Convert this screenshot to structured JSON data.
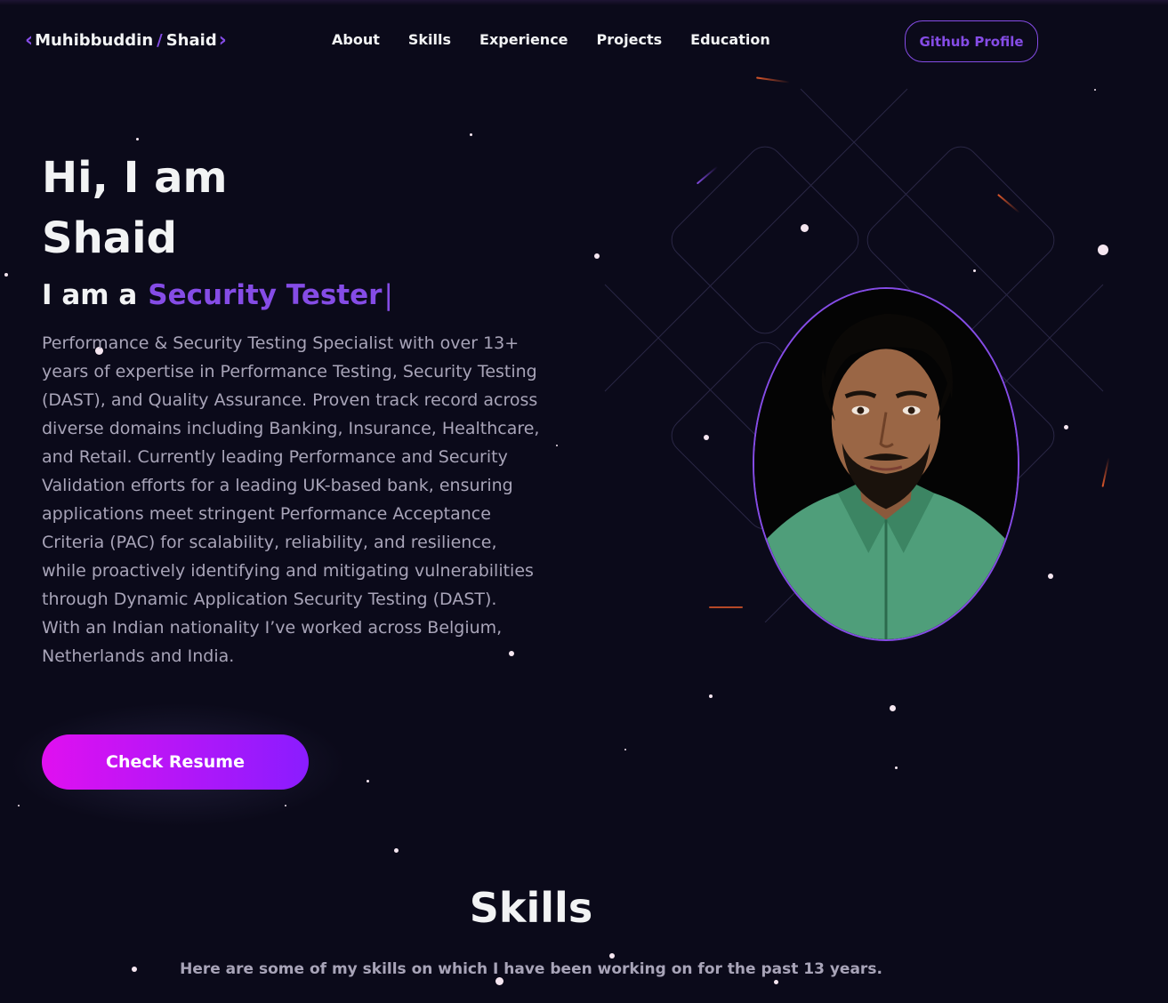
{
  "nav": {
    "logo_first": "Muhibbuddin",
    "logo_slash": "/",
    "logo_last": "Shaid",
    "links": [
      "About",
      "Skills",
      "Experience",
      "Projects",
      "Education"
    ],
    "github_label": "Github Profile"
  },
  "hero": {
    "title_line1": "Hi, I am",
    "title_line2": "Shaid",
    "role_prefix": "I am a",
    "role_typed": "Security Tester",
    "cursor": "|",
    "description": "Performance & Security Testing Specialist with over 13+ years of expertise in Performance Testing, Security Testing (DAST), and Quality Assurance. Proven track record across diverse domains including Banking, Insurance, Healthcare, and Retail. Currently leading Performance and Security Validation efforts for a leading UK-based bank, ensuring applications meet stringent Performance Acceptance Criteria (PAC) for scalability, reliability, and resilience, while proactively identifying and mitigating vulnerabilities through Dynamic Application Security Testing (DAST). With an Indian nationality I’ve worked across Belgium, Netherlands and India.",
    "resume_label": "Check Resume"
  },
  "skills": {
    "title": "Skills",
    "subtitle": "Here are some of my skills on which I have been working on for the past 13 years."
  },
  "colors": {
    "background": "#0b0a1a",
    "accent": "#854ce6",
    "text_primary": "#f2f3f4",
    "text_secondary": "#a8a4b8",
    "button_gradient_start": "#e010f0",
    "button_gradient_end": "#8a1cff"
  },
  "icons": {
    "logo_left": "chevron-left-icon",
    "logo_right": "chevron-right-icon"
  }
}
